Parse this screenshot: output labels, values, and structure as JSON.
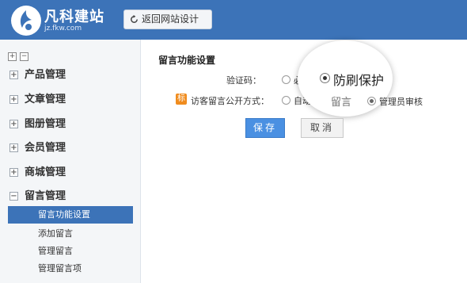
{
  "header": {
    "brand": "凡科建站",
    "brand_sub": "jz.fkw.com",
    "back_label": "返回网站设计",
    "color": "#3c73b8"
  },
  "sidebar": {
    "tree_tools": [
      "+",
      "−"
    ],
    "items": [
      {
        "label": "产品管理",
        "toggle": "+"
      },
      {
        "label": "文章管理",
        "toggle": "+"
      },
      {
        "label": "图册管理",
        "toggle": "+"
      },
      {
        "label": "会员管理",
        "toggle": "+"
      },
      {
        "label": "商城管理",
        "toggle": "+"
      },
      {
        "label": "留言管理",
        "toggle": "−"
      }
    ],
    "sub_items": [
      {
        "label": "留言功能设置",
        "active": true
      },
      {
        "label": "添加留言",
        "active": false
      },
      {
        "label": "管理留言",
        "active": false
      },
      {
        "label": "管理留言项",
        "active": false
      }
    ]
  },
  "main": {
    "title": "留言功能设置",
    "captcha": {
      "label": "验证码：",
      "options": [
        "必填",
        "防刷保护"
      ],
      "selected": "防刷保护"
    },
    "visitor": {
      "badge": "标",
      "label": "访客留言公开方式：",
      "options": [
        "自动公开",
        "管理员审核"
      ],
      "selected": "管理员审核"
    },
    "magnifier": {
      "text": "防刷保护",
      "ghost": "留言"
    },
    "save_label": "保存",
    "cancel_label": "取消"
  }
}
